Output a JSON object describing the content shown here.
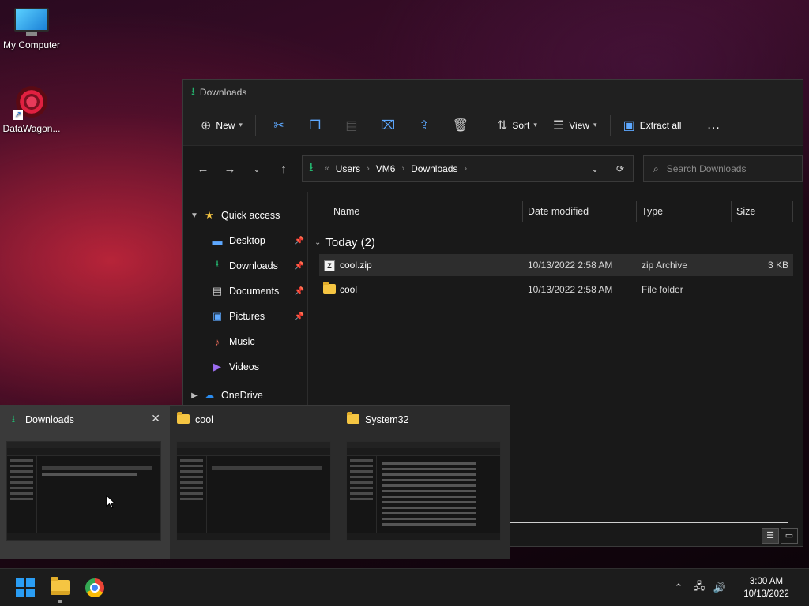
{
  "desktop": {
    "icons": [
      {
        "label": "My Computer",
        "icon": "monitor-icon"
      },
      {
        "label": "DataWagon...",
        "icon": "datawagon-logo-icon"
      }
    ]
  },
  "explorer": {
    "title": "Downloads",
    "toolbar": {
      "new_label": "New",
      "sort_label": "Sort",
      "view_label": "View",
      "extract_label": "Extract all",
      "more_label": "..."
    },
    "address": {
      "crumbs": [
        "Users",
        "VM6",
        "Downloads"
      ],
      "overflow": "«"
    },
    "search": {
      "placeholder": "Search Downloads"
    },
    "nav": {
      "quick_access": "Quick access",
      "items": [
        {
          "label": "Desktop",
          "pinned": true
        },
        {
          "label": "Downloads",
          "pinned": true
        },
        {
          "label": "Documents",
          "pinned": true
        },
        {
          "label": "Pictures",
          "pinned": true
        },
        {
          "label": "Music",
          "pinned": false
        },
        {
          "label": "Videos",
          "pinned": false
        }
      ],
      "onedrive": "OneDrive"
    },
    "columns": {
      "name": "Name",
      "date": "Date modified",
      "type": "Type",
      "size": "Size"
    },
    "group": "Today (2)",
    "files": [
      {
        "name": "cool.zip",
        "date": "10/13/2022 2:58 AM",
        "type": "zip Archive",
        "size": "3 KB",
        "selected": true
      },
      {
        "name": "cool",
        "date": "10/13/2022 2:58 AM",
        "type": "File folder",
        "size": "",
        "selected": false
      }
    ]
  },
  "thumbnails": [
    {
      "title": "Downloads",
      "active": true
    },
    {
      "title": "cool",
      "active": false
    },
    {
      "title": "System32",
      "active": false
    }
  ],
  "taskbar": {
    "time": "3:00 AM",
    "date": "10/13/2022"
  },
  "colors": {
    "accent_green": "#23b26d",
    "accent_blue": "#2a9df4",
    "folder_yellow": "#f5c542"
  }
}
